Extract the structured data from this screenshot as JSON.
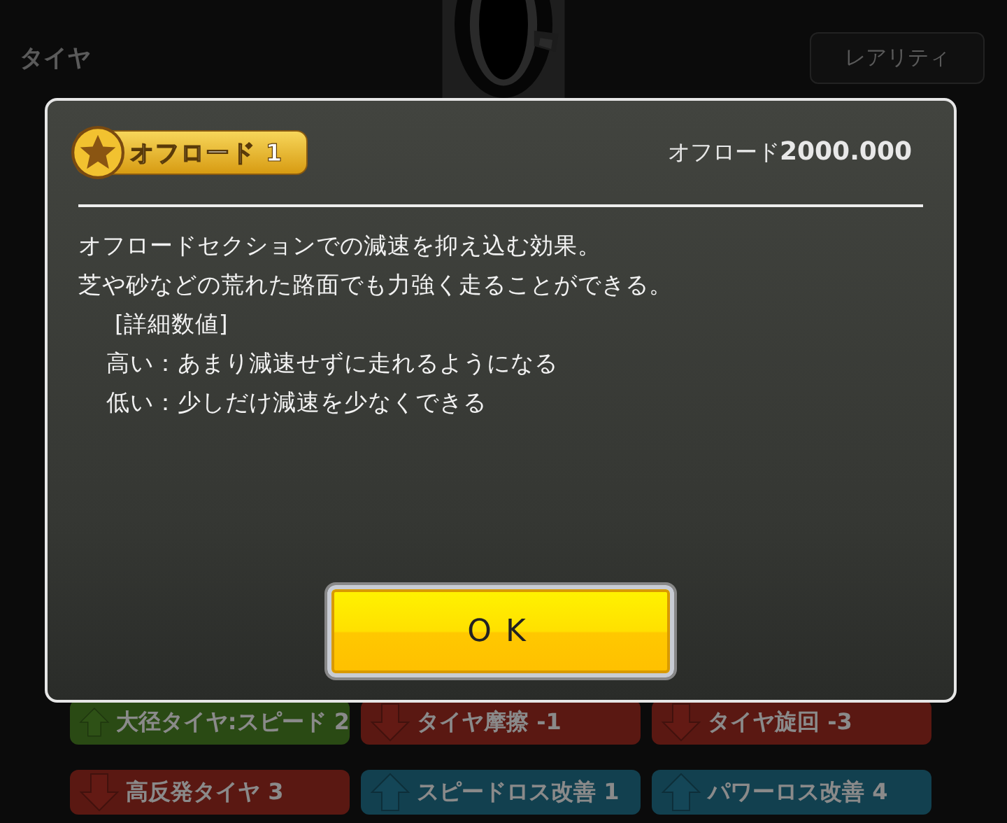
{
  "background": {
    "header": {
      "title": "タイヤ",
      "buttons": [
        "レアリティ"
      ]
    },
    "tags": [
      {
        "label": "大径タイヤ:スピード 2",
        "kind": "up",
        "color": "#2a4a14"
      },
      {
        "label": "タイヤ摩擦 -1",
        "kind": "down",
        "color": "#5a1812"
      },
      {
        "label": "タイヤ旋回 -3",
        "kind": "down",
        "color": "#5a1812"
      },
      {
        "label": "高反発タイヤ 3",
        "kind": "down",
        "color": "#5a1812"
      },
      {
        "label": "スピードロス改善 1",
        "kind": "up",
        "color": "#12404f"
      },
      {
        "label": "パワーロス改善 4",
        "kind": "up",
        "color": "#12404f"
      }
    ]
  },
  "dialog": {
    "badge": "オフロード 1",
    "stat": "オフロード**2000.000**",
    "lines": [
      {
        "text": "オフロードセクションでの減速を抑え込む効果。",
        "kind": "body"
      },
      {
        "text": "芝や砂などの荒れた路面でも力強く走ることができる。",
        "kind": "body"
      },
      {
        "text": "[詳細数値]",
        "kind": "heading"
      },
      {
        "text": "高い：あまり減速せずに走れるようになる",
        "kind": "detail"
      },
      {
        "text": "低い：少しだけ減速を少なくできる",
        "kind": "detail"
      }
    ],
    "button": "OK"
  }
}
